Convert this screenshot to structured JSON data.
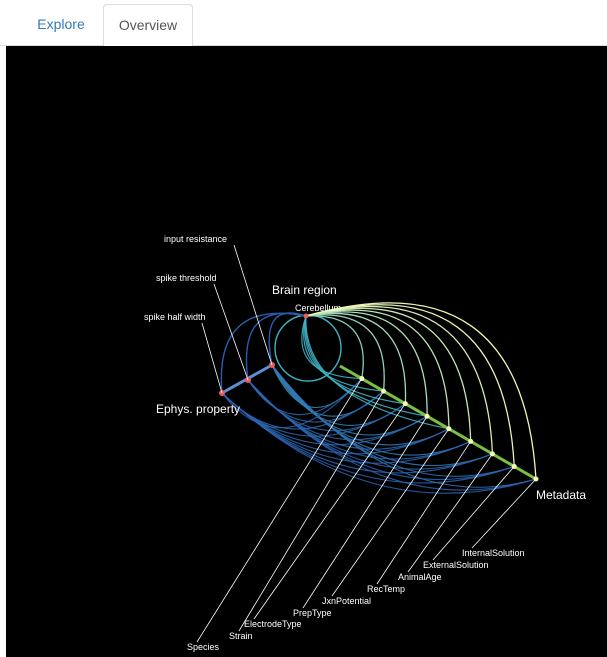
{
  "tabs": [
    {
      "label": "Explore",
      "active": false
    },
    {
      "label": "Overview",
      "active": true
    }
  ],
  "diagram": {
    "axes": {
      "brain_region": "Brain region",
      "ephys": "Ephys. property",
      "metadata": "Metadata"
    },
    "nodes": {
      "brain_region": [
        "Cerebellum"
      ],
      "ephys": [
        "input resistance",
        "spike threshold",
        "spike half width"
      ],
      "metadata": [
        "InternalSolution",
        "ExternalSolution",
        "AnimalAge",
        "RecTemp",
        "JxnPotential",
        "PrepType",
        "ElectrodeType",
        "Strain",
        "Species"
      ]
    },
    "colors": {
      "background": "#000000",
      "link_low": "#2a5db0",
      "link_mid": "#3fb3c4",
      "link_high": "#f2f7b0",
      "metadata_axis": "#7ac143",
      "ephys_axis": "#5b8fd6",
      "node_red": "#e85c5c"
    }
  }
}
